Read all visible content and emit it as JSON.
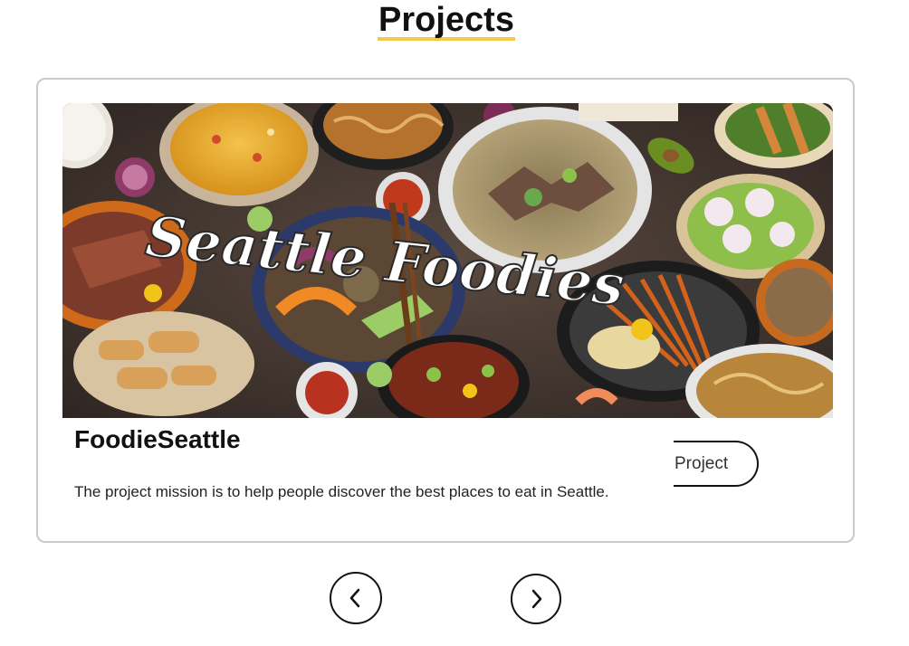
{
  "page": {
    "title": "Projects"
  },
  "project": {
    "image_caption": "Seattle Foodies",
    "title": "FoodieSeattle",
    "description": "The project mission is to help people discover the best places to eat in Seattle.",
    "button_label": "Project"
  },
  "carousel": {
    "prev_icon": "chevron-left-icon",
    "next_icon": "chevron-right-icon"
  },
  "colors": {
    "title_underline": "#f2c94c",
    "card_border": "#c9c9c9",
    "text": "#111111"
  }
}
